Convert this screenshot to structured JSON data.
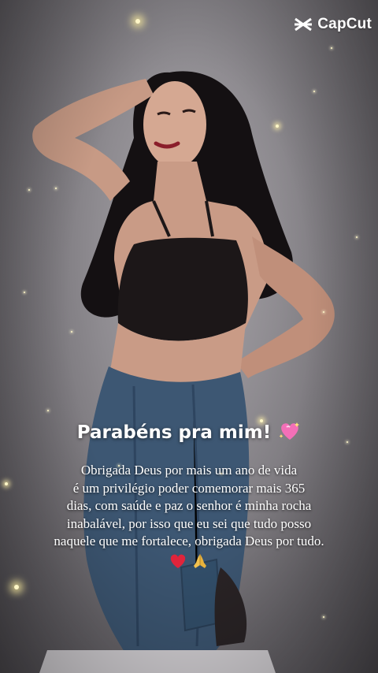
{
  "logo": {
    "text": "CapCut",
    "icon": "capcut-logo-icon"
  },
  "overlay": {
    "title": "Parabéns pra mim!",
    "title_emoji": "sparkling-heart-icon",
    "message_lines": [
      "Obrigada Deus por mais um ano de vida",
      "é um privilégio poder comemorar mais 365",
      "dias, com saúde e paz o senhor é minha rocha",
      "inabalável, por isso que eu sei que tudo posso",
      "naquele que me fortalece, obrigada Deus por tudo."
    ],
    "trailing_emojis": [
      "red-heart-icon",
      "praying-hands-icon"
    ]
  },
  "colors": {
    "background": "#8e8b90",
    "text": "#ffffff",
    "sparkle": "#fff7c8",
    "heart": "#e0243b",
    "title_emoji": "#f36fb7"
  }
}
